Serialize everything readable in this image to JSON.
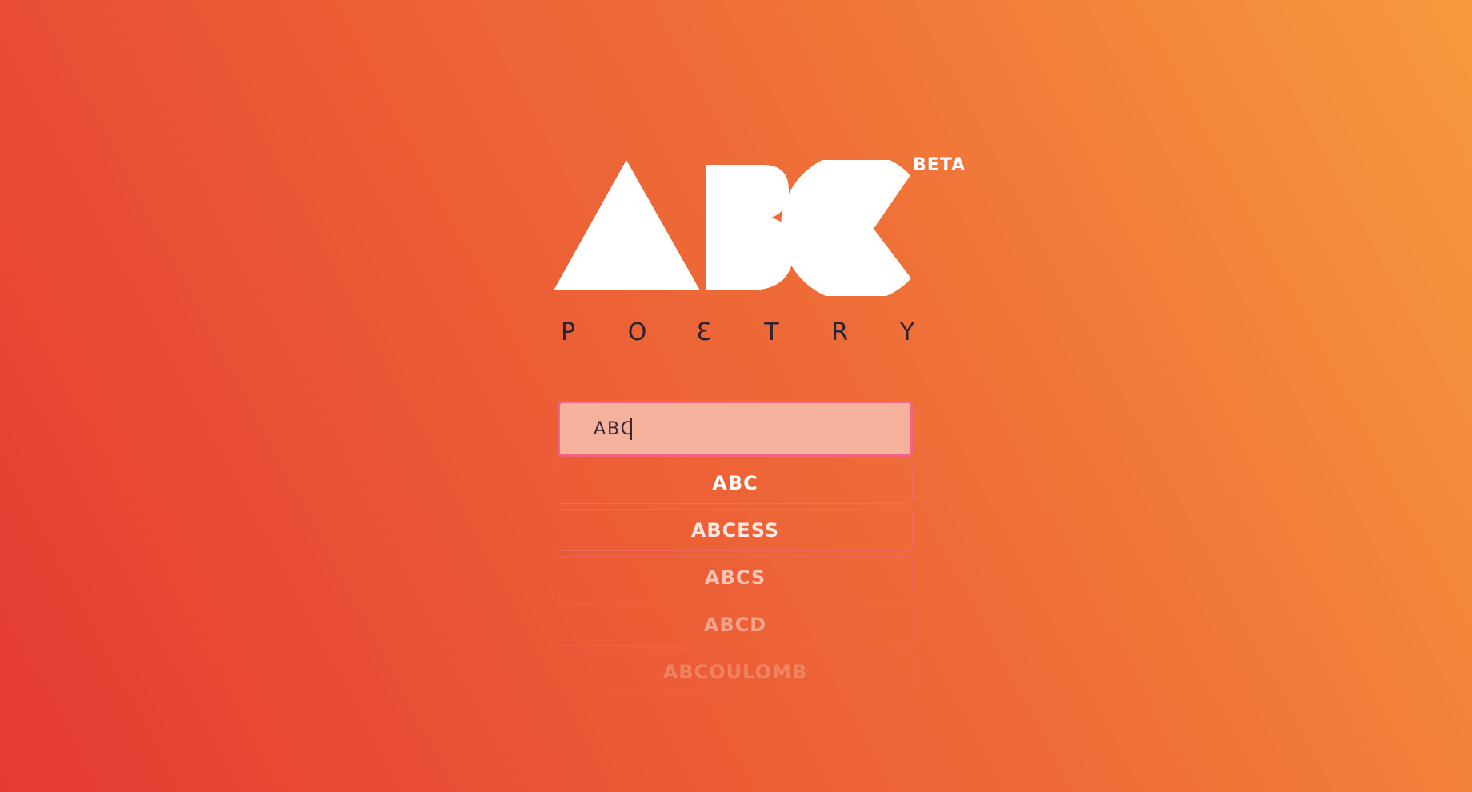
{
  "brand": {
    "logo_text": "ABC",
    "badge": "BETA",
    "tagline_letters": [
      "P",
      "O",
      "Ɛ",
      "T",
      "R",
      "Y"
    ]
  },
  "search": {
    "value": "ABC"
  },
  "suggestions": [
    "ABC",
    "ABCESS",
    "ABCS",
    "ABCD",
    "ABCOULOMB"
  ],
  "colors": {
    "gradient_start": "#e53a33",
    "gradient_end": "#f69a3e",
    "input_fill": "#f4b29d",
    "input_border": "#f2647f",
    "tagline": "#2d2230",
    "logo": "#ffffff"
  }
}
